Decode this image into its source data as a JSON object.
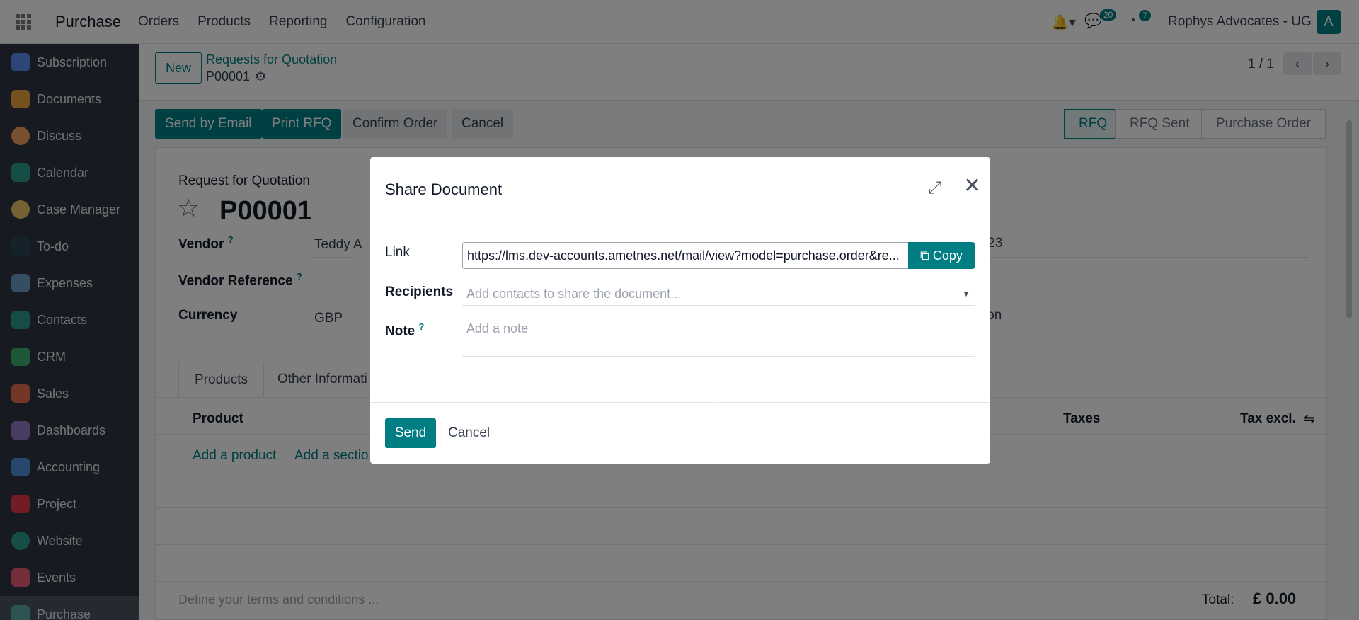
{
  "navbar": {
    "app_name": "Purchase",
    "menu": [
      "Orders",
      "Products",
      "Reporting",
      "Configuration"
    ],
    "messages_count": "20",
    "activities_count": "7",
    "company": "Rophys Advocates - UG",
    "avatar_letter": "A"
  },
  "sidebar": {
    "items": [
      {
        "label": "Subscription",
        "color": "#5b8def"
      },
      {
        "label": "Documents",
        "color": "#e8a33d"
      },
      {
        "label": "Discuss",
        "color": "#f4a261"
      },
      {
        "label": "Calendar",
        "color": "#2a9d8f"
      },
      {
        "label": "Case Manager",
        "color": "#e9c46a"
      },
      {
        "label": "To-do",
        "color": "#264653"
      },
      {
        "label": "Expenses",
        "color": "#6d9dc5"
      },
      {
        "label": "Contacts",
        "color": "#2a9d8f"
      },
      {
        "label": "CRM",
        "color": "#3bb273"
      },
      {
        "label": "Sales",
        "color": "#e76f51"
      },
      {
        "label": "Dashboards",
        "color": "#8e7cc3"
      },
      {
        "label": "Accounting",
        "color": "#4a90d9"
      },
      {
        "label": "Project",
        "color": "#e63946"
      },
      {
        "label": "Website",
        "color": "#2a9d8f"
      },
      {
        "label": "Events",
        "color": "#e85d75"
      },
      {
        "label": "Purchase",
        "color": "#5aa9a6"
      }
    ]
  },
  "control_panel": {
    "new_label": "New",
    "breadcrumb_parent": "Requests for Quotation",
    "breadcrumb_current": "P00001",
    "pager": "1 / 1"
  },
  "actions": {
    "send_email": "Send by Email",
    "print_rfq": "Print RFQ",
    "confirm_order": "Confirm Order",
    "cancel": "Cancel"
  },
  "statusbar": [
    "RFQ",
    "RFQ Sent",
    "Purchase Order"
  ],
  "form": {
    "subtitle": "Request for Quotation",
    "reference": "P00001",
    "vendor_label": "Vendor",
    "vendor_value": "Teddy A",
    "vendor_ref_label": "Vendor Reference",
    "currency_label": "Currency",
    "currency_value": "GBP",
    "right_value_1": ":23",
    "right_value_2": "ion",
    "tabs": [
      "Products",
      "Other Informati"
    ],
    "columns": {
      "product": "Product",
      "taxes": "Taxes",
      "tax_excl": "Tax excl."
    },
    "add_product": "Add a product",
    "add_section": "Add a sectio",
    "terms_placeholder": "Define your terms and conditions ...",
    "total_label": "Total:",
    "total_value": "£ 0.00"
  },
  "modal": {
    "title": "Share Document",
    "link_label": "Link",
    "link_value": "https://lms.dev-accounts.ametnes.net/mail/view?model=purchase.order&re...",
    "copy_label": "Copy",
    "recipients_label": "Recipients",
    "recipients_placeholder": "Add contacts to share the document...",
    "note_label": "Note",
    "note_placeholder": "Add a note",
    "send_label": "Send",
    "cancel_label": "Cancel"
  }
}
